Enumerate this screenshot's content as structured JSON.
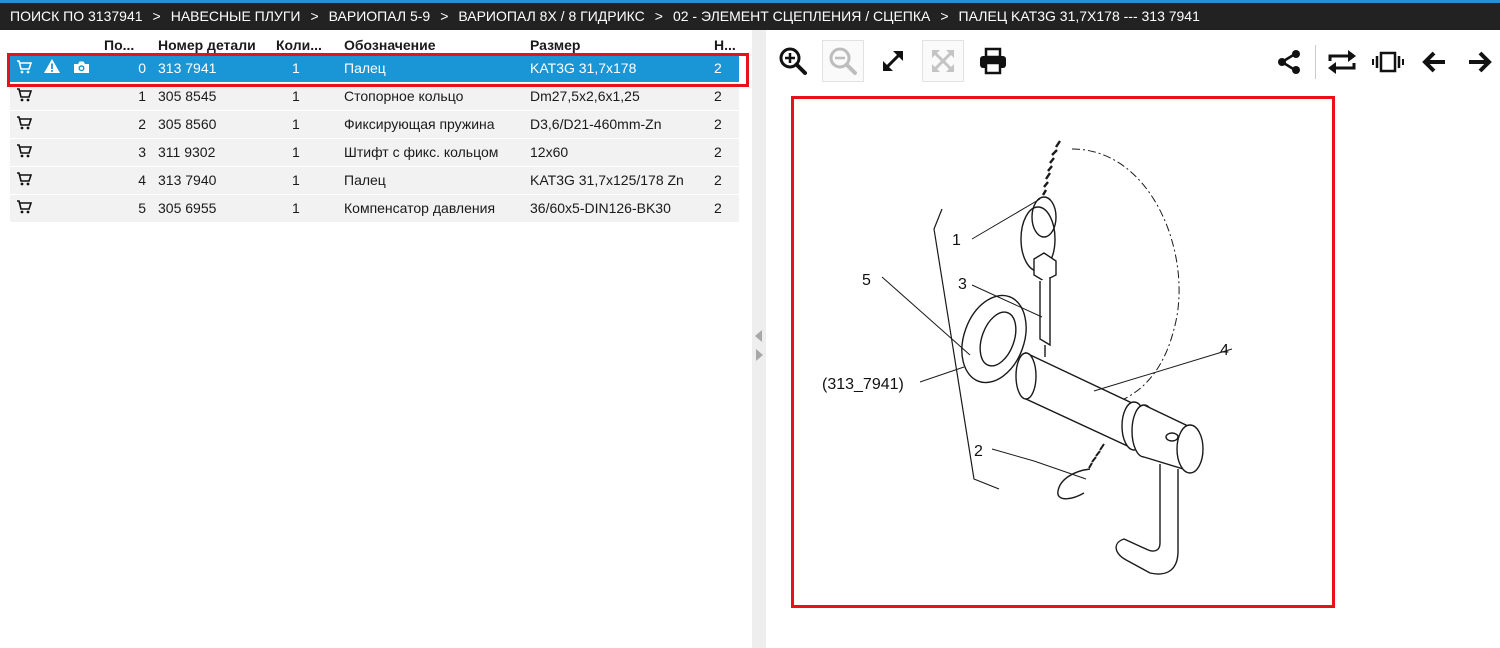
{
  "breadcrumb": [
    "ПОИСК ПО 3137941",
    "НАВЕСНЫЕ ПЛУГИ",
    "ВАРИОПАЛ 5-9",
    "ВАРИОПАЛ 8X / 8 ГИДРИКС",
    "02 - ЭЛЕМЕНТ СЦЕПЛЕНИЯ / СЦЕПКА",
    "ПАЛЕЦ KAT3G 31,7X178 --- 313 7941"
  ],
  "breadcrumb_separator": ">",
  "table": {
    "headers": {
      "pos": "По...",
      "part_number": "Номер детали",
      "qty": "Коли...",
      "designation": "Обозначение",
      "size": "Размер",
      "note": "Н..."
    },
    "rows": [
      {
        "pos": "0",
        "part_number": "313 7941",
        "qty": "1",
        "designation": "Палец",
        "size": "KAT3G 31,7x178",
        "note": "2",
        "selected": true,
        "warning": true
      },
      {
        "pos": "1",
        "part_number": "305 8545",
        "qty": "1",
        "designation": "Стопорное кольцо",
        "size": "Dm27,5x2,6x1,25",
        "note": "2",
        "selected": false,
        "warning": false
      },
      {
        "pos": "2",
        "part_number": "305 8560",
        "qty": "1",
        "designation": "Фиксирующая пружина",
        "size": "D3,6/D21-460mm-Zn",
        "note": "2",
        "selected": false,
        "warning": false
      },
      {
        "pos": "3",
        "part_number": "311 9302",
        "qty": "1",
        "designation": "Штифт с фикс. кольцом",
        "size": "12x60",
        "note": "2",
        "selected": false,
        "warning": false
      },
      {
        "pos": "4",
        "part_number": "313 7940",
        "qty": "1",
        "designation": "Палец",
        "size": "KAT3G 31,7x125/178 Zn",
        "note": "2",
        "selected": false,
        "warning": false
      },
      {
        "pos": "5",
        "part_number": "305 6955",
        "qty": "1",
        "designation": "Компенсатор давления",
        "size": "36/60x5-DIN126-BK30",
        "note": "2",
        "selected": false,
        "warning": false
      }
    ]
  },
  "row_icons": [
    "cart-icon",
    "warning-icon",
    "camera-icon"
  ],
  "toolbar_left": [
    "zoom-in-icon",
    "zoom-out-icon",
    "fullscreen-icon",
    "exit-fullscreen-icon",
    "print-icon"
  ],
  "toolbar_right": [
    "share-icon",
    "swap-icon",
    "carousel-icon",
    "arrow-left-icon",
    "arrow-right-icon"
  ],
  "drawing": {
    "callouts": [
      "1",
      "2",
      "3",
      "4",
      "5"
    ],
    "assembly_label": "(313_7941)"
  },
  "colors": {
    "topbar_bg": "#222222",
    "topbar_accent": "#2a8fcf",
    "selected_row": "#1a95d6",
    "highlight_outline": "#e8101a",
    "row_bg": "#f2f2f2"
  }
}
